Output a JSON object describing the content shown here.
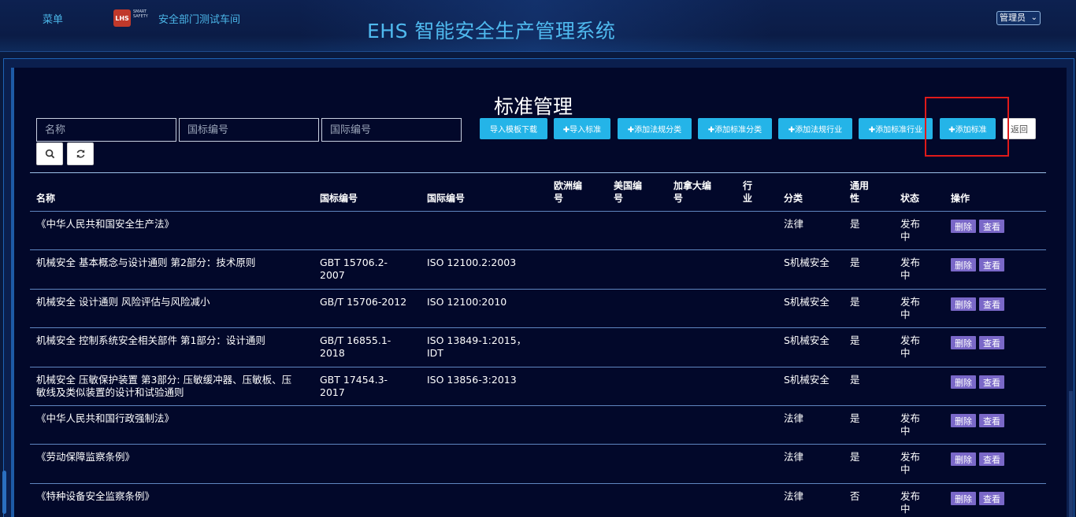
{
  "header": {
    "menu_label": "菜单",
    "logo_text": "LHS",
    "logo_sub": "SMART SAFETY",
    "dept_label": "安全部门测试车间",
    "system_title": "EHS 智能安全生产管理系统",
    "user_label": "管理员",
    "user_chevron": "⌄"
  },
  "page": {
    "title": "标准管理"
  },
  "search": {
    "name_placeholder": "名称",
    "code1_placeholder": "国标编号",
    "code2_placeholder": "国际编号",
    "search_icon": "🔍",
    "refresh_icon": "⟳"
  },
  "actions": {
    "import_template": "导入模板下载",
    "import_standard": "✚导入标准",
    "add_law_category": "✚添加法规分类",
    "add_std_category": "✚添加标准分类",
    "add_law_industry": "✚添加法规行业",
    "add_std_industry": "✚添加标准行业",
    "add_standard": "✚添加标准",
    "back": "返回"
  },
  "table": {
    "headers": {
      "name": "名称",
      "gb": "国标编号",
      "iso": "国际编号",
      "eu": "欧洲编号",
      "us": "美国编号",
      "ca": "加拿大编号",
      "industry": "行业",
      "category": "分类",
      "general": "通用性",
      "status": "状态",
      "ops": "操作"
    },
    "delete_label": "删除",
    "view_label": "查看",
    "rows": [
      {
        "name": "《中华人民共和国安全生产法》",
        "gb": "",
        "iso": "",
        "category": "法律",
        "general": "是",
        "status": "发布中"
      },
      {
        "name": "机械安全 基本概念与设计通则 第2部分：技术原则",
        "gb": "GBT 15706.2-2007",
        "iso": "ISO 12100.2:2003",
        "category": "S机械安全",
        "general": "是",
        "status": "发布中"
      },
      {
        "name": "机械安全 设计通则 风险评估与风险减小",
        "gb": "GB/T 15706-2012",
        "iso": "ISO 12100:2010",
        "category": "S机械安全",
        "general": "是",
        "status": "发布中"
      },
      {
        "name": "机械安全 控制系统安全相关部件 第1部分：设计通则",
        "gb": "GB/T 16855.1-2018",
        "iso": "ISO 13849-1:2015，IDT",
        "category": "S机械安全",
        "general": "是",
        "status": "发布中"
      },
      {
        "name": "机械安全 压敏保护装置 第3部分: 压敏缓冲器、压敏板、压敏线及类似装置的设计和试验通则",
        "gb": "GBT 17454.3-2017",
        "iso": "ISO 13856-3:2013",
        "category": "S机械安全",
        "general": "是",
        "status": ""
      },
      {
        "name": "《中华人民共和国行政强制法》",
        "gb": "",
        "iso": "",
        "category": "法律",
        "general": "是",
        "status": "发布中"
      },
      {
        "name": "《劳动保障监察条例》",
        "gb": "",
        "iso": "",
        "category": "法律",
        "general": "是",
        "status": "发布中"
      },
      {
        "name": "《特种设备安全监察条例》",
        "gb": "",
        "iso": "",
        "category": "法律",
        "general": "否",
        "status": "发布中"
      }
    ]
  },
  "colors": {
    "accent": "#24b4e8",
    "op_button": "#7a68c8",
    "highlight": "#e01a1a"
  }
}
